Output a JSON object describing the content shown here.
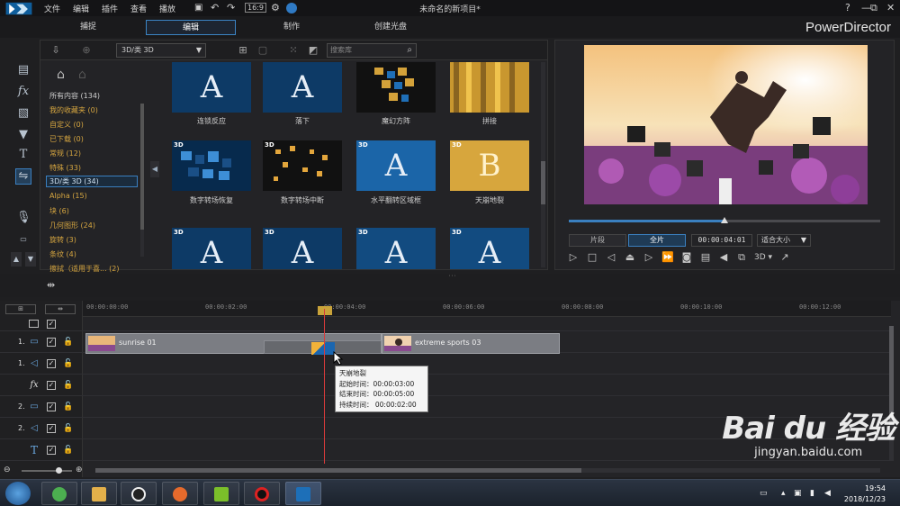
{
  "titlebar": {
    "menus": [
      "文件",
      "编辑",
      "插件",
      "查看",
      "播放"
    ],
    "title": "未命名的新项目*",
    "window_controls": [
      "?",
      "—",
      "⧉",
      "✕"
    ]
  },
  "modes": {
    "tabs": [
      "捕捉",
      "编辑",
      "制作",
      "创建光盘"
    ],
    "active": "编辑",
    "brand": "PowerDirector"
  },
  "library": {
    "category": "3D/类 3D",
    "search_placeholder": "搜索库",
    "categories": [
      {
        "label": "所有内容 (134)",
        "color": "white"
      },
      {
        "label": "我的收藏夹  (0)",
        "color": "orange"
      },
      {
        "label": "自定义  (0)",
        "color": "orange"
      },
      {
        "label": "已下载  (0)",
        "color": "orange"
      },
      {
        "label": "常规  (12)",
        "color": "orange"
      },
      {
        "label": "特殊  (33)",
        "color": "orange"
      },
      {
        "label": "3D/类 3D  (34)",
        "color": "selected"
      },
      {
        "label": "Alpha  (15)",
        "color": "orange"
      },
      {
        "label": "块  (6)",
        "color": "orange"
      },
      {
        "label": "几何图形  (24)",
        "color": "orange"
      },
      {
        "label": "旋转  (3)",
        "color": "orange"
      },
      {
        "label": "条纹  (4)",
        "color": "orange"
      },
      {
        "label": "擦拭（适用于喜...  (2)",
        "color": "orange"
      }
    ],
    "transitions": [
      {
        "label": "连锁反应",
        "letter": "A",
        "badge": ""
      },
      {
        "label": "落下",
        "letter": "A",
        "badge": ""
      },
      {
        "label": "魔幻方阵",
        "letter": "",
        "badge": ""
      },
      {
        "label": "拼接",
        "letter": "",
        "badge": ""
      },
      {
        "label": "数字转场恢复",
        "letter": "",
        "badge": "3D"
      },
      {
        "label": "数字转场中断",
        "letter": "",
        "badge": "3D"
      },
      {
        "label": "水平翻转区域框",
        "letter": "A",
        "badge": "3D"
      },
      {
        "label": "天崩地裂",
        "letter": "B",
        "badge": "3D"
      },
      {
        "label": "",
        "letter": "A",
        "badge": "3D"
      },
      {
        "label": "",
        "letter": "A",
        "badge": "3D"
      },
      {
        "label": "",
        "letter": "A",
        "badge": "3D"
      },
      {
        "label": "",
        "letter": "A",
        "badge": "3D"
      }
    ]
  },
  "preview": {
    "toggle_clip": "片段",
    "toggle_full": "全片",
    "timecode": "00:00:04:01",
    "fit": "适合大小",
    "mode_3d": "3D",
    "scrub_progress": 0.5
  },
  "timeline": {
    "ruler": [
      "00:00:00:00",
      "00:00:02:00",
      "00:00:04:00",
      "00:00:06:00",
      "00:00:08:00",
      "00:00:10:00",
      "00:00:12:00"
    ],
    "tracks": [
      {
        "num": "",
        "kind": "header"
      },
      {
        "num": "1.",
        "kind": "video"
      },
      {
        "num": "1.",
        "kind": "audio"
      },
      {
        "num": "",
        "kind": "fx"
      },
      {
        "num": "2.",
        "kind": "video"
      },
      {
        "num": "2.",
        "kind": "audio"
      },
      {
        "num": "",
        "kind": "title"
      }
    ],
    "clips": {
      "clip1": "sunrise 01",
      "clip2": "extreme sports 03"
    },
    "tooltip": {
      "title": "天崩地裂",
      "start": "起始时间：00:00:03:00",
      "end": "结束时间：00:00:05:00",
      "duration": "持续时间：  00:00:02:00"
    }
  },
  "taskbar": {
    "time": "19:54",
    "date": "2018/12/23"
  },
  "watermark": {
    "logo": "Bai du 经验",
    "url": "jingyan.baidu.com"
  },
  "colors": {
    "accent": "#3a7fbf",
    "category_text": "#d6a640",
    "playhead": "#d83a3a"
  }
}
